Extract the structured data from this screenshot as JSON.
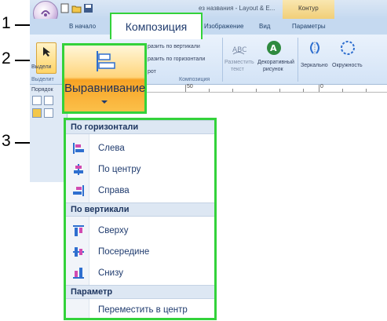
{
  "callouts": [
    "1",
    "2",
    "3"
  ],
  "titlebar": {
    "window_title": "ез названия - Layout & E...",
    "context_tab": "Контур"
  },
  "tabs": {
    "home": "В начало",
    "composition": "Композиция",
    "image": "Изображение",
    "view": "Вид",
    "params": "Параметры"
  },
  "ribbon": {
    "select_label": "Выдели",
    "select_group": "Выделит",
    "align_vertical": "разить по вертикали",
    "align_horizontal": "разить по горизонтали",
    "rotate": "рот",
    "group_composition": "Композиция",
    "place_text_line1": "Разместить",
    "place_text_line2": "текст",
    "decor_line1": "Декоративный",
    "decor_line2": "рисунок",
    "mirror": "Зеркально",
    "circle": "Окружность"
  },
  "left_panel": {
    "order_label": "Порядок"
  },
  "ruler": {
    "mark_50": "50",
    "mark_0": "0"
  },
  "align_button": {
    "label": "Выравнивание"
  },
  "menu": {
    "sections": [
      {
        "header": "По горизонтали",
        "items": [
          {
            "label": "Слева",
            "icon": "align-left-icon"
          },
          {
            "label": "По центру",
            "icon": "align-center-icon"
          },
          {
            "label": "Справа",
            "icon": "align-right-icon"
          }
        ]
      },
      {
        "header": "По вертикали",
        "items": [
          {
            "label": "Сверху",
            "icon": "align-top-icon"
          },
          {
            "label": "Посередине",
            "icon": "align-middle-icon"
          },
          {
            "label": "Снизу",
            "icon": "align-bottom-icon"
          }
        ]
      },
      {
        "header": "Параметр",
        "items": [
          {
            "label": "Переместить в центр",
            "icon": null
          }
        ]
      }
    ]
  },
  "colors": {
    "highlight_frame": "#33d23a",
    "icon_blue": "#2f6fcf",
    "icon_pink": "#d14bb1",
    "menu_text": "#1f3b6e"
  }
}
